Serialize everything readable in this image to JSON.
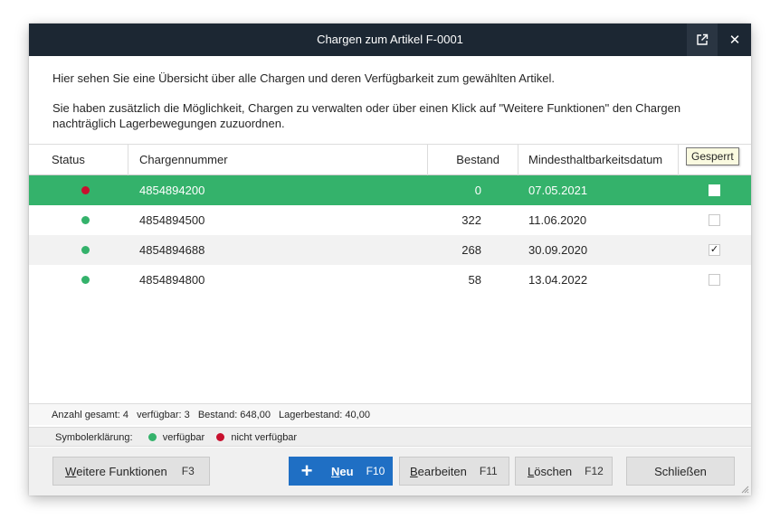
{
  "window": {
    "title": "Chargen zum Artikel F-0001",
    "popout_icon": "external-link-icon",
    "close_label": "✕"
  },
  "intro": {
    "line1": "Hier sehen Sie eine Übersicht über alle Chargen und deren Verfügbarkeit zum gewählten Artikel.",
    "line2": "Sie haben zusätzlich die Möglichkeit, Chargen zu verwalten oder über einen Klick auf \"Weitere Funktionen\" den Chargen nachträglich Lagerbewegungen zuzuordnen."
  },
  "table": {
    "columns": {
      "status": "Status",
      "chargennummer": "Chargennummer",
      "bestand": "Bestand",
      "mhd": "Mindesthaltbarkeitsdatum",
      "gesperrt": "Gesperrt"
    },
    "tooltip": "Gesperrt",
    "rows": [
      {
        "status": "nicht verfügbar",
        "status_color": "#c8102e",
        "chargennummer": "4854894200",
        "bestand": "0",
        "mhd": "07.05.2021",
        "gesperrt": false,
        "selected": true
      },
      {
        "status": "verfügbar",
        "status_color": "#34b26b",
        "chargennummer": "4854894500",
        "bestand": "322",
        "mhd": "11.06.2020",
        "gesperrt": false,
        "selected": false
      },
      {
        "status": "verfügbar",
        "status_color": "#34b26b",
        "chargennummer": "4854894688",
        "bestand": "268",
        "mhd": "30.09.2020",
        "gesperrt": true,
        "selected": false
      },
      {
        "status": "verfügbar",
        "status_color": "#34b26b",
        "chargennummer": "4854894800",
        "bestand": "58",
        "mhd": "13.04.2022",
        "gesperrt": false,
        "selected": false
      }
    ]
  },
  "summary": {
    "anzahl": "Anzahl gesamt: 4",
    "verfuegbar": "verfügbar: 3",
    "bestand": "Bestand: 648,00",
    "lagerbestand": "Lagerbestand: 40,00"
  },
  "legend": {
    "title": "Symbolerklärung:",
    "available_label": "verfügbar",
    "available_color": "#34b26b",
    "unavailable_label": "nicht verfügbar",
    "unavailable_color": "#c8102e"
  },
  "buttons": {
    "weitere": {
      "underline": "W",
      "rest": "eitere Funktionen",
      "key": "F3"
    },
    "neu": {
      "icon": "+",
      "underline": "N",
      "rest": "eu",
      "key": "F10"
    },
    "bearbeiten": {
      "underline": "B",
      "rest": "earbeiten",
      "key": "F11"
    },
    "loeschen": {
      "underline": "L",
      "rest": "öschen",
      "key": "F12"
    },
    "schliessen": {
      "label": "Schließen"
    }
  },
  "colors": {
    "titlebar": "#1c2733",
    "selected_row": "#34b26b",
    "primary_button": "#1f6fc4"
  }
}
